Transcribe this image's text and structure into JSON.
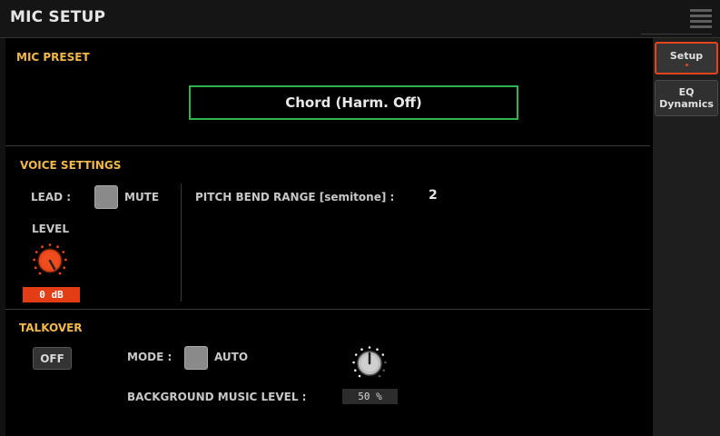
{
  "header": {
    "title": "MIC SETUP",
    "menu_icon": "hamburger-menu-icon"
  },
  "tabs": [
    {
      "label": "Setup",
      "selected": true
    },
    {
      "label_line1": "EQ",
      "label_line2": "Dynamics",
      "selected": false
    }
  ],
  "mic_preset": {
    "heading": "MIC PRESET",
    "value": "Chord (Harm. Off)"
  },
  "voice_settings": {
    "heading": "VOICE SETTINGS",
    "lead_label": "LEAD :",
    "mute_label": "MUTE",
    "level_label": "LEVEL",
    "level_value": "0 dB",
    "pitch_bend_label": "PITCH BEND RANGE [semitone] :",
    "pitch_bend_value": "2"
  },
  "talkover": {
    "heading": "TALKOVER",
    "button_label": "OFF",
    "mode_label": "MODE :",
    "auto_label": "AUTO",
    "bgm_label": "BACKGROUND MUSIC LEVEL :",
    "bgm_value": "50 %"
  },
  "colors": {
    "accent": "#e2451e",
    "section_heading": "#f2b84a",
    "preset_border": "#2fb34a"
  }
}
